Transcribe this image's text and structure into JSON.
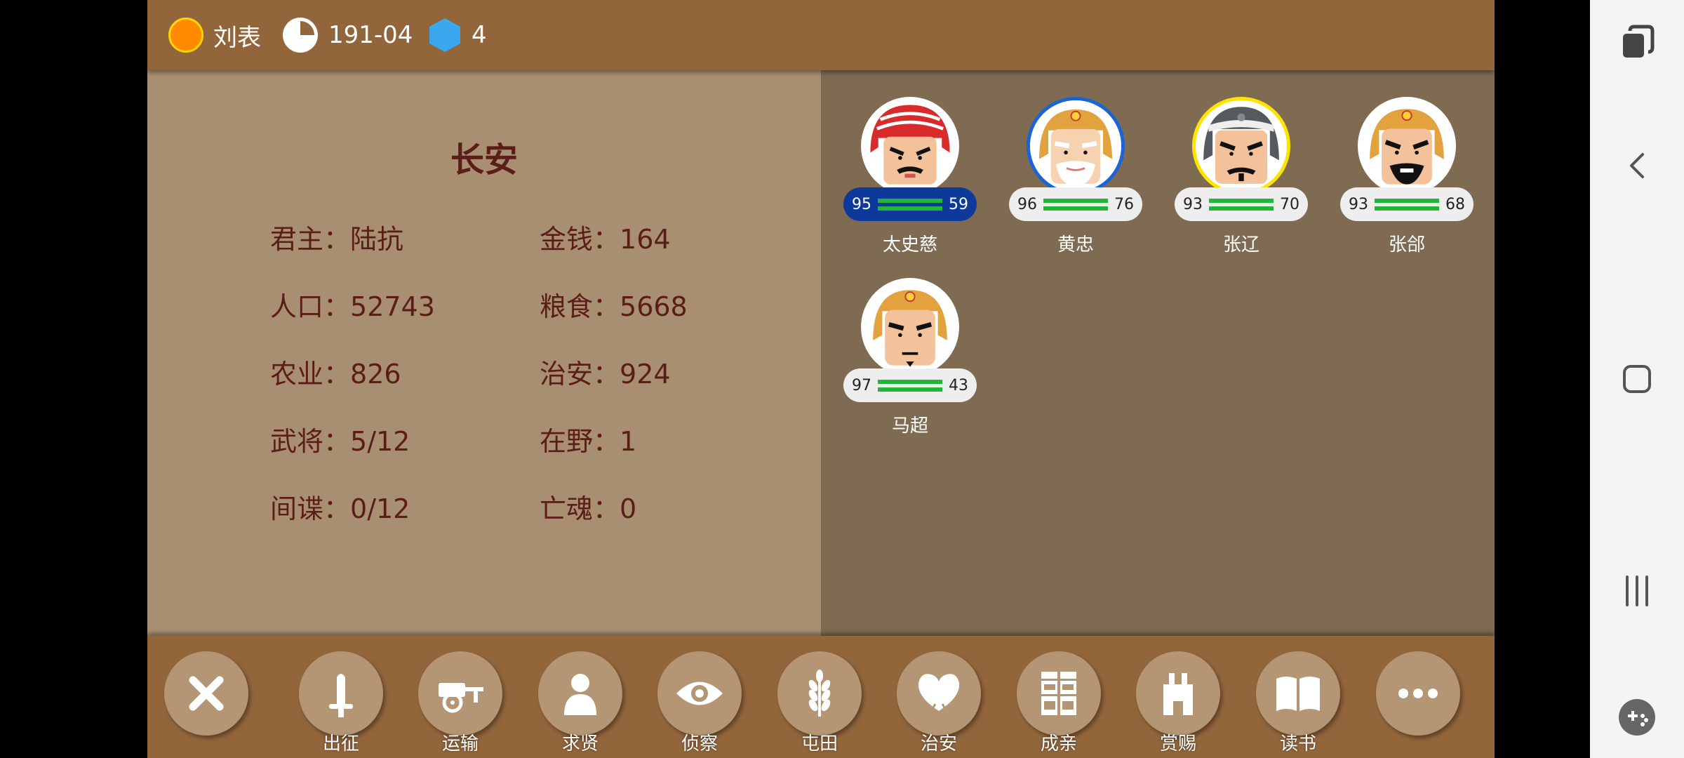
{
  "topbar": {
    "lord_name": "刘表",
    "date": "191-04",
    "gems": "4"
  },
  "city": {
    "name": "长安",
    "stats": [
      {
        "label": "君主：",
        "value": "陆抗"
      },
      {
        "label": "金钱：",
        "value": "164"
      },
      {
        "label": "人口：",
        "value": "52743"
      },
      {
        "label": "粮食：",
        "value": "5668"
      },
      {
        "label": "农业：",
        "value": "826"
      },
      {
        "label": "治安：",
        "value": "924"
      },
      {
        "label": "武将：",
        "value": "5/12"
      },
      {
        "label": "在野：",
        "value": "1"
      },
      {
        "label": "间谍：",
        "value": "0/12"
      },
      {
        "label": "亡魂：",
        "value": "0"
      }
    ]
  },
  "generals": [
    {
      "name": "太史慈",
      "left": "95",
      "right": "59"
    },
    {
      "name": "黄忠",
      "left": "96",
      "right": "76"
    },
    {
      "name": "张辽",
      "left": "93",
      "right": "70"
    },
    {
      "name": "张郃",
      "left": "93",
      "right": "68"
    },
    {
      "name": "马超",
      "left": "97",
      "right": "43"
    }
  ],
  "toolbar": {
    "actions": [
      {
        "label": "出征",
        "icon": "sword-icon"
      },
      {
        "label": "运输",
        "icon": "cart-icon"
      },
      {
        "label": "求贤",
        "icon": "person-icon"
      },
      {
        "label": "侦察",
        "icon": "eye-icon"
      },
      {
        "label": "屯田",
        "icon": "wheat-icon"
      },
      {
        "label": "治安",
        "icon": "shield-heart-icon"
      },
      {
        "label": "成亲",
        "icon": "double-happiness-icon"
      },
      {
        "label": "赏赐",
        "icon": "treasure-icon"
      },
      {
        "label": "读书",
        "icon": "book-icon"
      }
    ]
  },
  "colors": {
    "wood": "#93653b",
    "left_panel": "#a98f72",
    "right_panel": "#7e6b52",
    "text_dark_red": "#5b1d17",
    "selected_stat": "#0d3a9a",
    "bar_green": "#22b53a"
  }
}
